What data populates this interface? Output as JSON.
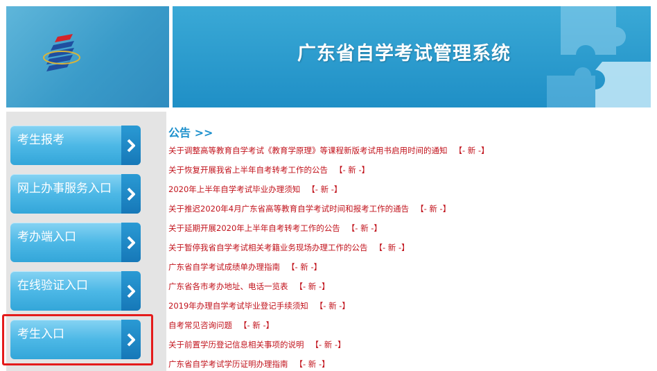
{
  "header": {
    "title": "广东省自学考试管理系统"
  },
  "sidebar": {
    "items": [
      {
        "label": "考生报考"
      },
      {
        "label": "网上办事服务入口"
      },
      {
        "label": "考办端入口"
      },
      {
        "label": "在线验证入口"
      },
      {
        "label": "考生入口"
      }
    ]
  },
  "notices": {
    "title": "公告 >>",
    "new_tag": "【- 新 -】",
    "items": [
      {
        "text": "关于调整高等教育自学考试《教育学原理》等课程新版考试用书启用时间的通知"
      },
      {
        "text": "关于恢复开展我省上半年自考转考工作的公告"
      },
      {
        "text": "2020年上半年自学考试毕业办理须知"
      },
      {
        "text": "关于推迟2020年4月广东省高等教育自学考试时间和报考工作的通告"
      },
      {
        "text": "关于延期开展2020年上半年自考转考工作的公告"
      },
      {
        "text": "关于暂停我省自学考试相关考籍业务现场办理工作的公告"
      },
      {
        "text": "广东省自学考试成绩单办理指南"
      },
      {
        "text": "广东省各市考办地址、电话一览表"
      },
      {
        "text": "2019年办理自学考试毕业登记手续须知"
      },
      {
        "text": "自考常见咨询问题"
      },
      {
        "text": "关于前置学历登记信息相关事项的说明"
      },
      {
        "text": "广东省自学考试学历证明办理指南"
      }
    ]
  },
  "colors": {
    "accent": "#1a8fcc",
    "notice_text": "#c1121b",
    "highlight": "#e41b1b"
  }
}
